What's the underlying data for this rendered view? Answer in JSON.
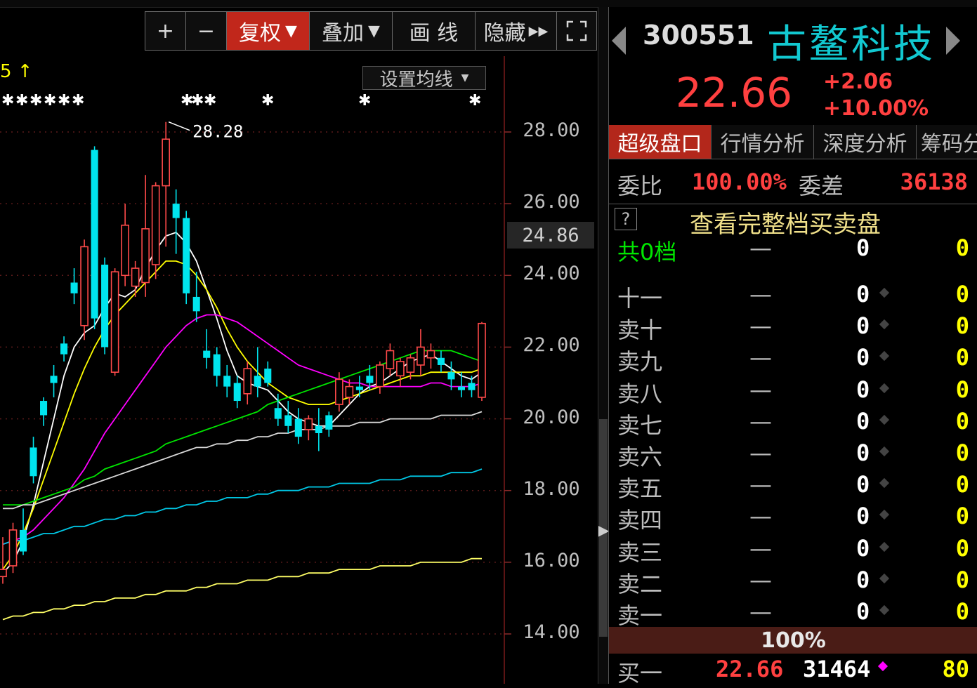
{
  "toolbar": {
    "zoom_in": "+",
    "zoom_out": "−",
    "fuquan": "复权",
    "overlay": "叠加",
    "draw_line": "画 线",
    "hide": "隐藏",
    "fullscreen_icon": "fullscreen-icon"
  },
  "ma_setting_label": "设置均线",
  "chart_data": {
    "type": "candlestick",
    "y_axis_ticks": [
      "28.00",
      "26.00",
      "24.00",
      "22.00",
      "20.00",
      "18.00",
      "16.00",
      "14.00"
    ],
    "ylim": [
      13.6,
      28.4
    ],
    "current_price_marker": "24.86",
    "high_annotation": "28.28",
    "top_left_marker": "5 ↑",
    "colors": {
      "up": "#ff4a4a",
      "down": "#00e5ee",
      "grid": "#5a1a1a"
    },
    "candles": [
      [
        15.6,
        16.7,
        15.4,
        15.8
      ],
      [
        15.9,
        17.1,
        15.7,
        16.9
      ],
      [
        16.9,
        17.5,
        16.2,
        16.3
      ],
      [
        19.2,
        19.5,
        18.2,
        18.4
      ],
      [
        20.5,
        20.6,
        19.8,
        20.1
      ],
      [
        21.2,
        21.5,
        20.6,
        21.0
      ],
      [
        22.1,
        22.3,
        21.6,
        21.8
      ],
      [
        23.8,
        24.2,
        23.2,
        23.5
      ],
      [
        22.6,
        25.0,
        22.2,
        24.8
      ],
      [
        27.5,
        27.6,
        22.5,
        22.8
      ],
      [
        24.3,
        24.5,
        21.8,
        22.0
      ],
      [
        21.3,
        24.2,
        21.2,
        24.1
      ],
      [
        24.0,
        26.0,
        23.7,
        25.4
      ],
      [
        23.7,
        24.4,
        23.4,
        24.2
      ],
      [
        23.8,
        26.8,
        23.4,
        25.3
      ],
      [
        24.3,
        26.6,
        23.9,
        26.5
      ],
      [
        26.5,
        28.28,
        24.8,
        27.8
      ],
      [
        26.0,
        26.4,
        24.6,
        25.6
      ],
      [
        25.6,
        25.8,
        23.2,
        23.5
      ],
      [
        23.4,
        24.1,
        22.7,
        23.0
      ],
      [
        21.9,
        22.5,
        21.4,
        21.7
      ],
      [
        21.8,
        22.0,
        20.9,
        21.2
      ],
      [
        21.2,
        21.5,
        20.6,
        20.9
      ],
      [
        21.0,
        21.2,
        20.3,
        20.5
      ],
      [
        20.7,
        21.6,
        20.4,
        21.4
      ],
      [
        21.2,
        22.0,
        20.6,
        20.9
      ],
      [
        21.4,
        21.6,
        20.9,
        21.0
      ],
      [
        20.3,
        20.7,
        19.8,
        20.0
      ],
      [
        20.1,
        20.5,
        19.6,
        19.8
      ],
      [
        20.0,
        20.3,
        19.3,
        19.5
      ],
      [
        19.7,
        20.1,
        19.4,
        20.0
      ],
      [
        19.8,
        20.3,
        19.1,
        19.6
      ],
      [
        20.1,
        20.2,
        19.5,
        19.7
      ],
      [
        20.4,
        21.3,
        20.2,
        21.1
      ],
      [
        20.6,
        21.1,
        20.4,
        20.9
      ],
      [
        20.9,
        21.2,
        20.6,
        20.8
      ],
      [
        21.2,
        21.5,
        20.8,
        21.0
      ],
      [
        20.9,
        21.6,
        20.7,
        21.5
      ],
      [
        21.4,
        22.1,
        21.2,
        21.9
      ],
      [
        21.2,
        21.7,
        20.9,
        21.6
      ],
      [
        21.3,
        21.8,
        21.1,
        21.7
      ],
      [
        21.5,
        22.5,
        21.2,
        22.0
      ],
      [
        21.7,
        22.1,
        21.4,
        21.9
      ],
      [
        21.7,
        21.9,
        21.3,
        21.5
      ],
      [
        21.3,
        21.6,
        20.8,
        21.1
      ],
      [
        20.9,
        21.3,
        20.6,
        20.8
      ],
      [
        21.0,
        21.2,
        20.6,
        20.8
      ],
      [
        20.6,
        22.7,
        20.5,
        22.66
      ]
    ],
    "ma_lines": [
      {
        "color": "#ffffff",
        "values": [
          15.7,
          16.0,
          16.6,
          17.6,
          18.8,
          20.0,
          21.2,
          22.0,
          22.4,
          22.6,
          23.1,
          23.5,
          23.4,
          23.6,
          24.2,
          24.7,
          25.1,
          25.2,
          24.9,
          24.4,
          23.6,
          22.8,
          21.9,
          21.2,
          21.0,
          20.9,
          20.8,
          20.5,
          20.2,
          20.0,
          19.9,
          19.8,
          19.8,
          20.1,
          20.4,
          20.7,
          20.9,
          21.0,
          21.2,
          21.4,
          21.6,
          21.7,
          21.8,
          21.6,
          21.4,
          21.2,
          21.1,
          21.3
        ]
      },
      {
        "color": "#ffff00",
        "values": [
          15.8,
          16.2,
          16.8,
          17.5,
          18.3,
          19.1,
          19.9,
          20.7,
          21.4,
          22.0,
          22.5,
          22.9,
          23.2,
          23.5,
          23.8,
          24.1,
          24.4,
          24.4,
          24.3,
          24.0,
          23.6,
          23.1,
          22.5,
          22.0,
          21.6,
          21.3,
          21.0,
          20.8,
          20.6,
          20.5,
          20.4,
          20.4,
          20.4,
          20.5,
          20.6,
          20.7,
          20.8,
          20.9,
          21.0,
          21.1,
          21.2,
          21.2,
          21.3,
          21.3,
          21.3,
          21.3,
          21.3,
          21.4
        ]
      },
      {
        "color": "#ff00ff",
        "values": [
          16.5,
          16.6,
          16.7,
          16.9,
          17.2,
          17.5,
          17.8,
          18.2,
          18.6,
          19.1,
          19.6,
          20.0,
          20.4,
          20.8,
          21.2,
          21.6,
          22.0,
          22.3,
          22.6,
          22.8,
          22.9,
          22.9,
          22.8,
          22.7,
          22.5,
          22.3,
          22.1,
          21.9,
          21.7,
          21.5,
          21.4,
          21.3,
          21.2,
          21.1,
          21.0,
          21.0,
          20.9,
          20.9,
          20.9,
          20.9,
          20.9,
          20.9,
          21.0,
          21.0,
          20.9,
          20.9,
          20.9,
          21.0
        ]
      },
      {
        "color": "#00e600",
        "values": [
          17.6,
          17.6,
          17.6,
          17.7,
          17.8,
          17.9,
          18.0,
          18.1,
          18.3,
          18.4,
          18.6,
          18.7,
          18.8,
          18.9,
          19.0,
          19.1,
          19.3,
          19.4,
          19.5,
          19.6,
          19.7,
          19.8,
          19.9,
          20.0,
          20.1,
          20.2,
          20.4,
          20.5,
          20.6,
          20.7,
          20.8,
          20.9,
          21.0,
          21.1,
          21.2,
          21.3,
          21.4,
          21.5,
          21.6,
          21.7,
          21.8,
          21.9,
          21.9,
          21.9,
          21.9,
          21.8,
          21.7,
          21.6
        ]
      },
      {
        "color": "#d8d8d8",
        "values": [
          17.5,
          17.5,
          17.6,
          17.6,
          17.7,
          17.8,
          17.9,
          18.0,
          18.1,
          18.2,
          18.3,
          18.4,
          18.5,
          18.6,
          18.7,
          18.8,
          18.9,
          19.0,
          19.1,
          19.2,
          19.2,
          19.3,
          19.3,
          19.4,
          19.4,
          19.5,
          19.5,
          19.6,
          19.6,
          19.7,
          19.7,
          19.7,
          19.8,
          19.8,
          19.8,
          19.9,
          19.9,
          19.9,
          20.0,
          20.0,
          20.0,
          20.0,
          20.0,
          20.1,
          20.1,
          20.1,
          20.1,
          20.2
        ]
      },
      {
        "color": "#00c8e6",
        "values": [
          16.5,
          16.6,
          16.6,
          16.7,
          16.8,
          16.8,
          16.9,
          17.0,
          17.0,
          17.1,
          17.2,
          17.2,
          17.3,
          17.3,
          17.4,
          17.4,
          17.5,
          17.5,
          17.6,
          17.6,
          17.7,
          17.7,
          17.8,
          17.8,
          17.8,
          17.9,
          17.9,
          18.0,
          18.0,
          18.0,
          18.1,
          18.1,
          18.1,
          18.2,
          18.2,
          18.2,
          18.2,
          18.3,
          18.3,
          18.3,
          18.4,
          18.4,
          18.4,
          18.4,
          18.5,
          18.5,
          18.5,
          18.6
        ]
      },
      {
        "color": "#ffff66",
        "values": [
          14.4,
          14.5,
          14.5,
          14.6,
          14.6,
          14.7,
          14.7,
          14.8,
          14.8,
          14.9,
          14.9,
          15.0,
          15.0,
          15.0,
          15.1,
          15.1,
          15.2,
          15.2,
          15.2,
          15.3,
          15.3,
          15.4,
          15.4,
          15.4,
          15.5,
          15.5,
          15.5,
          15.6,
          15.6,
          15.6,
          15.7,
          15.7,
          15.7,
          15.8,
          15.8,
          15.8,
          15.8,
          15.9,
          15.9,
          15.9,
          15.9,
          16.0,
          16.0,
          16.0,
          16.0,
          16.0,
          16.1,
          16.1
        ]
      }
    ]
  },
  "quote": {
    "code": "300551",
    "name": "古鳌科技",
    "last": "22.66",
    "change": "+2.06",
    "change_pct": "+10.00%",
    "tabs": [
      "超级盘口",
      "行情分析",
      "深度分析",
      "筹码分"
    ],
    "weibi_label": "委比",
    "weibi_value": "100.00%",
    "weicha_label": "委差",
    "weicha_value": "36138",
    "help_icon": "?",
    "full_book_text": "查看完整档买卖盘",
    "total_row": {
      "label": "共0档",
      "dash": "—",
      "vol": "0",
      "cnt": "0"
    },
    "ask_rows": [
      {
        "label": "十一",
        "dash": "—",
        "vol": "0",
        "cnt": "0"
      },
      {
        "label": "卖十",
        "dash": "—",
        "vol": "0",
        "cnt": "0"
      },
      {
        "label": "卖九",
        "dash": "—",
        "vol": "0",
        "cnt": "0"
      },
      {
        "label": "卖八",
        "dash": "—",
        "vol": "0",
        "cnt": "0"
      },
      {
        "label": "卖七",
        "dash": "—",
        "vol": "0",
        "cnt": "0"
      },
      {
        "label": "卖六",
        "dash": "—",
        "vol": "0",
        "cnt": "0"
      },
      {
        "label": "卖五",
        "dash": "—",
        "vol": "0",
        "cnt": "0"
      },
      {
        "label": "卖四",
        "dash": "—",
        "vol": "0",
        "cnt": "0"
      },
      {
        "label": "卖三",
        "dash": "—",
        "vol": "0",
        "cnt": "0"
      },
      {
        "label": "卖二",
        "dash": "—",
        "vol": "0",
        "cnt": "0"
      },
      {
        "label": "卖一",
        "dash": "—",
        "vol": "0",
        "cnt": "0"
      }
    ],
    "pct_bar": "100%",
    "buy1": {
      "label": "买一",
      "price": "22.66",
      "vol": "31464",
      "cnt": "80"
    }
  }
}
